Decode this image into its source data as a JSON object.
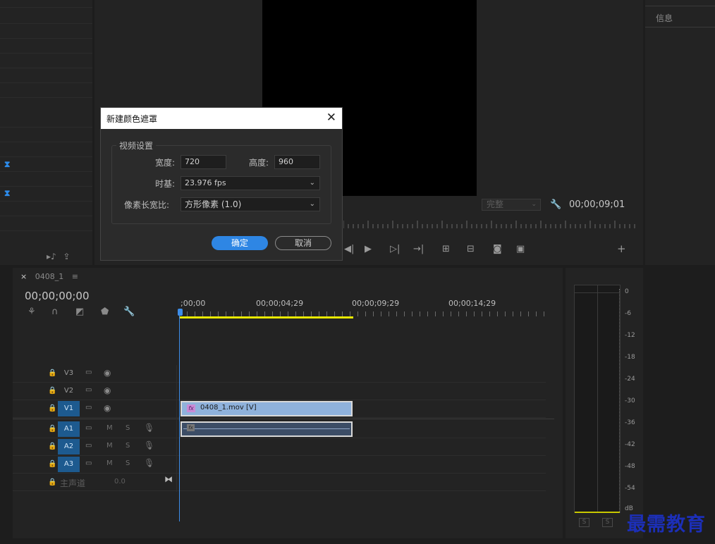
{
  "dialog": {
    "title": "新建颜色遮罩",
    "group_label": "视频设置",
    "width_label": "宽度:",
    "width_value": "720",
    "height_label": "高度:",
    "height_value": "960",
    "timebase_label": "时基:",
    "timebase_value": "23.976 fps",
    "par_label": "像素长宽比:",
    "par_value": "方形像素 (1.0)",
    "ok": "确定",
    "cancel": "取消"
  },
  "program": {
    "fit_value": "完整",
    "timecode": "00;00;09;01"
  },
  "right_panel": {
    "info_tab": "信息"
  },
  "timeline": {
    "tab_name": "0408_1",
    "timecode": "00;00;00;00",
    "ruler_labels": [
      ";00;00",
      "00;00;04;29",
      "00;00;09;29",
      "00;00;14;29"
    ],
    "tracks": [
      {
        "name": "V3",
        "type": "video",
        "target": false
      },
      {
        "name": "V2",
        "type": "video",
        "target": false
      },
      {
        "name": "V1",
        "type": "video",
        "target": true
      },
      {
        "name": "A1",
        "type": "audio",
        "target": true
      },
      {
        "name": "A2",
        "type": "audio",
        "target": true
      },
      {
        "name": "A3",
        "type": "audio",
        "target": true
      }
    ],
    "master_label": "主声道",
    "master_value": "0.0",
    "clip_v1_label": "0408_1.mov [V]",
    "m_label": "M",
    "s_label": "S"
  },
  "meter": {
    "db_labels": [
      "0",
      "-6",
      "-12",
      "-18",
      "-24",
      "-30",
      "-36",
      "-42",
      "-48",
      "-54",
      "dB"
    ],
    "solo_left": "S",
    "solo_right": "S"
  },
  "watermark": "最需教育",
  "colors": {
    "accent": "#2e86e4",
    "track_target": "#1d5a8f",
    "work_area": "#e8e800",
    "clip_video": "#8fb2dc",
    "clip_audio": "#3c4d66"
  }
}
